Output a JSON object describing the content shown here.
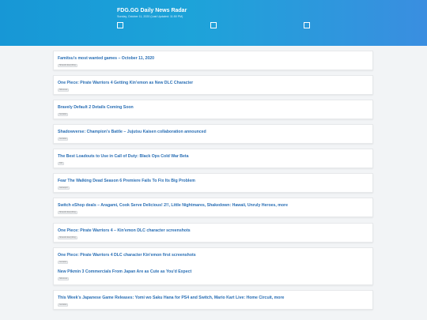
{
  "header": {
    "title": "FDG.GG Daily News Radar",
    "subtitle": "Sunday, October 11, 2020 (Last Updated: 11:50 PM)"
  },
  "icons": {
    "checkbox": "checkbox-icon"
  },
  "colors": {
    "header_start": "#1797d6",
    "header_end": "#3a8ee0",
    "link": "#2a6fb5"
  },
  "articles": [
    {
      "title": "Famitsu's most wanted games – October 11, 2020",
      "source": "Nintendo Everything"
    },
    {
      "title": "One Piece: Pirate Warriors 4 Getting Kin'emon as New DLC Character",
      "source": "Siliconera"
    },
    {
      "title": "Bravely Default 2 Details Coming Soon",
      "source": "Gematsu"
    },
    {
      "title": "Shadowverse: Champion's Battle – Jujutsu Kaisen collaboration announced",
      "source": "Gematsu"
    },
    {
      "title": "The Best Loadouts to Use in Call of Duty: Black Ops Cold War Beta",
      "source": "IGN"
    },
    {
      "title": "Fear The Walking Dead Season 6 Premiere Fails To Fix Its Big Problem",
      "source": "Gamespot"
    },
    {
      "title": "Switch eShop deals – Aragami, Cook Serve Delicious! 2!!, Little Nightmares, Shakedown: Hawaii, Unruly Heroes, more",
      "source": "Nintendo Everything"
    },
    {
      "title": "One Piece: Pirate Warriors 4 – Kin'emon DLC character screenshots",
      "source": "Nintendo Everything"
    },
    {
      "title": "One Piece: Pirate Warriors 4 DLC character Kin'emon first screenshots",
      "source": "Gematsu"
    },
    {
      "title": "New Pikmin 3 Commercials From Japan Are as Cute as You'd Expect",
      "source": "Siliconera"
    },
    {
      "title": "This Week's Japanese Game Releases: Yomi wo Saku Hana for PS4 and Switch, Mario Kart Live: Home Circuit, more",
      "source": "Gematsu"
    }
  ]
}
